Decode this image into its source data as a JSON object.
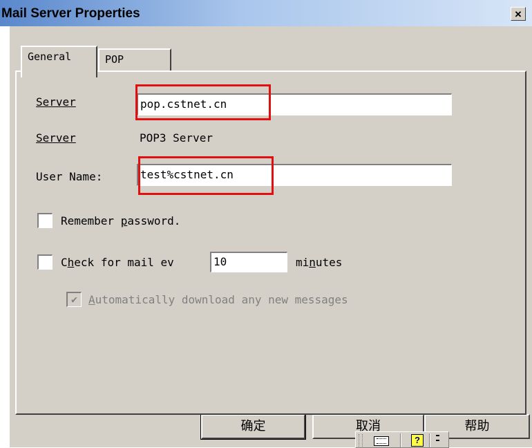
{
  "window": {
    "title": "Mail Server Properties",
    "close_glyph": "×"
  },
  "tabs": [
    {
      "label": "General",
      "selected": true
    },
    {
      "label": "POP",
      "selected": false
    }
  ],
  "form": {
    "server_label": "Server",
    "server_value": "pop.cstnet.cn",
    "server_type_label": "Server",
    "server_type_value": "POP3 Server",
    "username_label": "User Name:",
    "username_value": "test%cstnet.cn",
    "remember_password": {
      "label_pre": "Remember ",
      "label_access": "p",
      "label_post": "assword.",
      "checked": false
    },
    "check_mail": {
      "label_pre": "C",
      "label_access": "h",
      "label_mid": "eck for mail ev",
      "value": "10",
      "unit_pre": "mi",
      "unit_access": "n",
      "unit_post": "utes",
      "checked": false
    },
    "auto_download": {
      "label_access": "A",
      "label_post": "utomatically download any new messages",
      "checked": true,
      "enabled": false
    }
  },
  "buttons": {
    "ok": "确定",
    "cancel": "取消",
    "help": "帮助"
  },
  "language_bar": {
    "keyboard_icon": "keyboard-icon",
    "help_icon_glyph": "?",
    "options_icon": "menu-icon"
  },
  "colors": {
    "title_gradient_start": "#5a88cc",
    "dialog_face": "#d4d0c8",
    "highlight_box": "#e01010"
  }
}
